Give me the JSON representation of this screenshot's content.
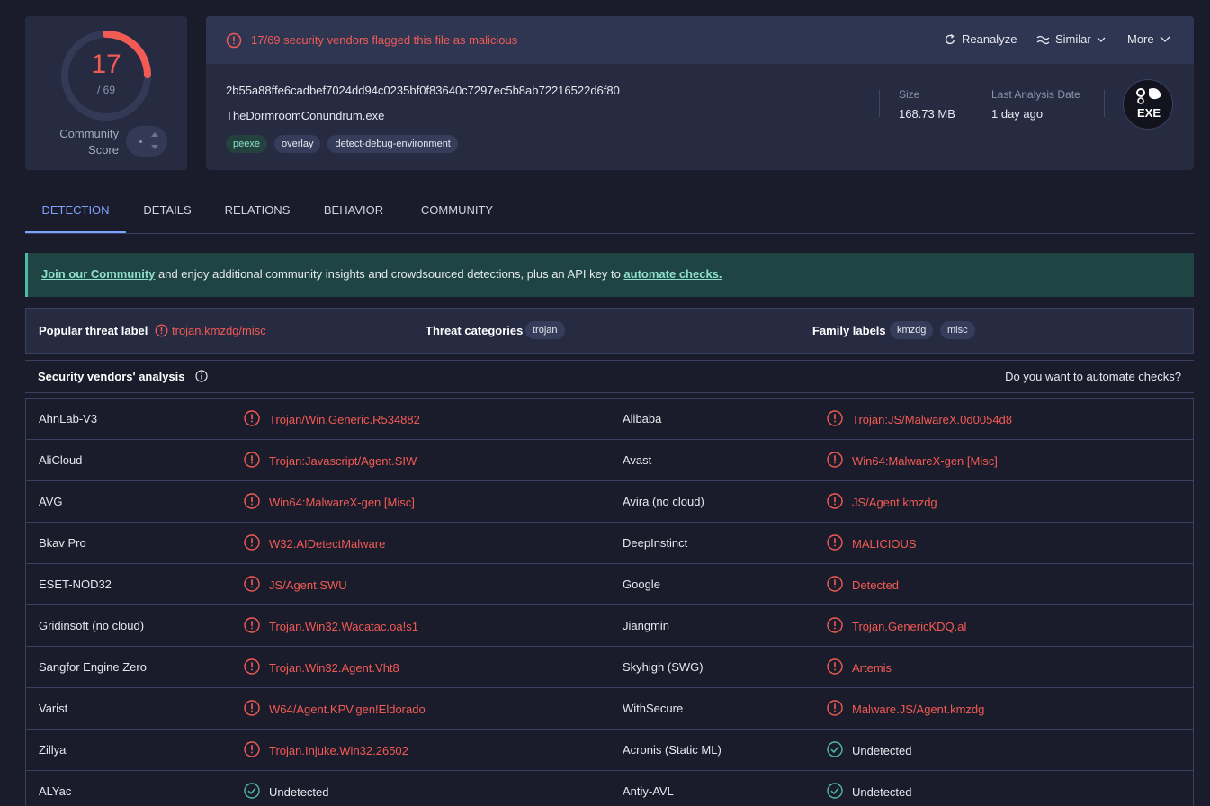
{
  "score": {
    "detections": "17",
    "total": "/ 69",
    "community_label": "Community Score",
    "fraction": 0.2464
  },
  "header": {
    "alert": "17/69 security vendors flagged this file as malicious",
    "reanalyze": "Reanalyze",
    "similar": "Similar",
    "more": "More"
  },
  "file": {
    "hash": "2b55a88ffe6cadbef7024dd94c0235bf0f83640c7297ec5b8ab72216522d6f80",
    "name": "TheDormroomConundrum.exe",
    "tags": [
      "peexe",
      "overlay",
      "detect-debug-environment"
    ],
    "size_label": "Size",
    "size_value": "168.73 MB",
    "date_label": "Last Analysis Date",
    "date_value": "1 day ago",
    "type_badge": "EXE"
  },
  "tabs": [
    "DETECTION",
    "DETAILS",
    "RELATIONS",
    "BEHAVIOR",
    "COMMUNITY"
  ],
  "banner": {
    "link1": "Join our Community",
    "middle": " and enjoy additional community insights and crowdsourced detections, plus an API key to ",
    "link2": "automate checks."
  },
  "threat": {
    "popular_label": "Popular threat label",
    "popular_value": "trojan.kmzdg/misc",
    "categories_label": "Threat categories",
    "categories": [
      "trojan"
    ],
    "family_label": "Family labels",
    "families": [
      "kmzdg",
      "misc"
    ]
  },
  "vendors_header": {
    "title": "Security vendors' analysis",
    "automate": "Do you want to automate checks?"
  },
  "vendors": [
    [
      "AhnLab-V3",
      "Trojan/Win.Generic.R534882",
      "Alibaba",
      "Trojan:JS/MalwareX.0d0054d8"
    ],
    [
      "AliCloud",
      "Trojan:Javascript/Agent.SIW",
      "Avast",
      "Win64:MalwareX-gen [Misc]"
    ],
    [
      "AVG",
      "Win64:MalwareX-gen [Misc]",
      "Avira (no cloud)",
      "JS/Agent.kmzdg"
    ],
    [
      "Bkav Pro",
      "W32.AIDetectMalware",
      "DeepInstinct",
      "MALICIOUS"
    ],
    [
      "ESET-NOD32",
      "JS/Agent.SWU",
      "Google",
      "Detected"
    ],
    [
      "Gridinsoft (no cloud)",
      "Trojan.Win32.Wacatac.oa!s1",
      "Jiangmin",
      "Trojan.GenericKDQ.al"
    ],
    [
      "Sangfor Engine Zero",
      "Trojan.Win32.Agent.Vht8",
      "Skyhigh (SWG)",
      "Artemis"
    ],
    [
      "Varist",
      "W64/Agent.KPV.gen!Eldorado",
      "WithSecure",
      "Malware.JS/Agent.kmzdg"
    ],
    [
      "Zillya",
      "Trojan.Injuke.Win32.26502",
      "Acronis (Static ML)",
      "Undetected"
    ],
    [
      "ALYac",
      "Undetected",
      "Antiy-AVL",
      "Undetected"
    ]
  ],
  "colors": {
    "malicious": "#f25a54",
    "clean": "#4fb9a3",
    "accent": "#7ea3ff"
  }
}
